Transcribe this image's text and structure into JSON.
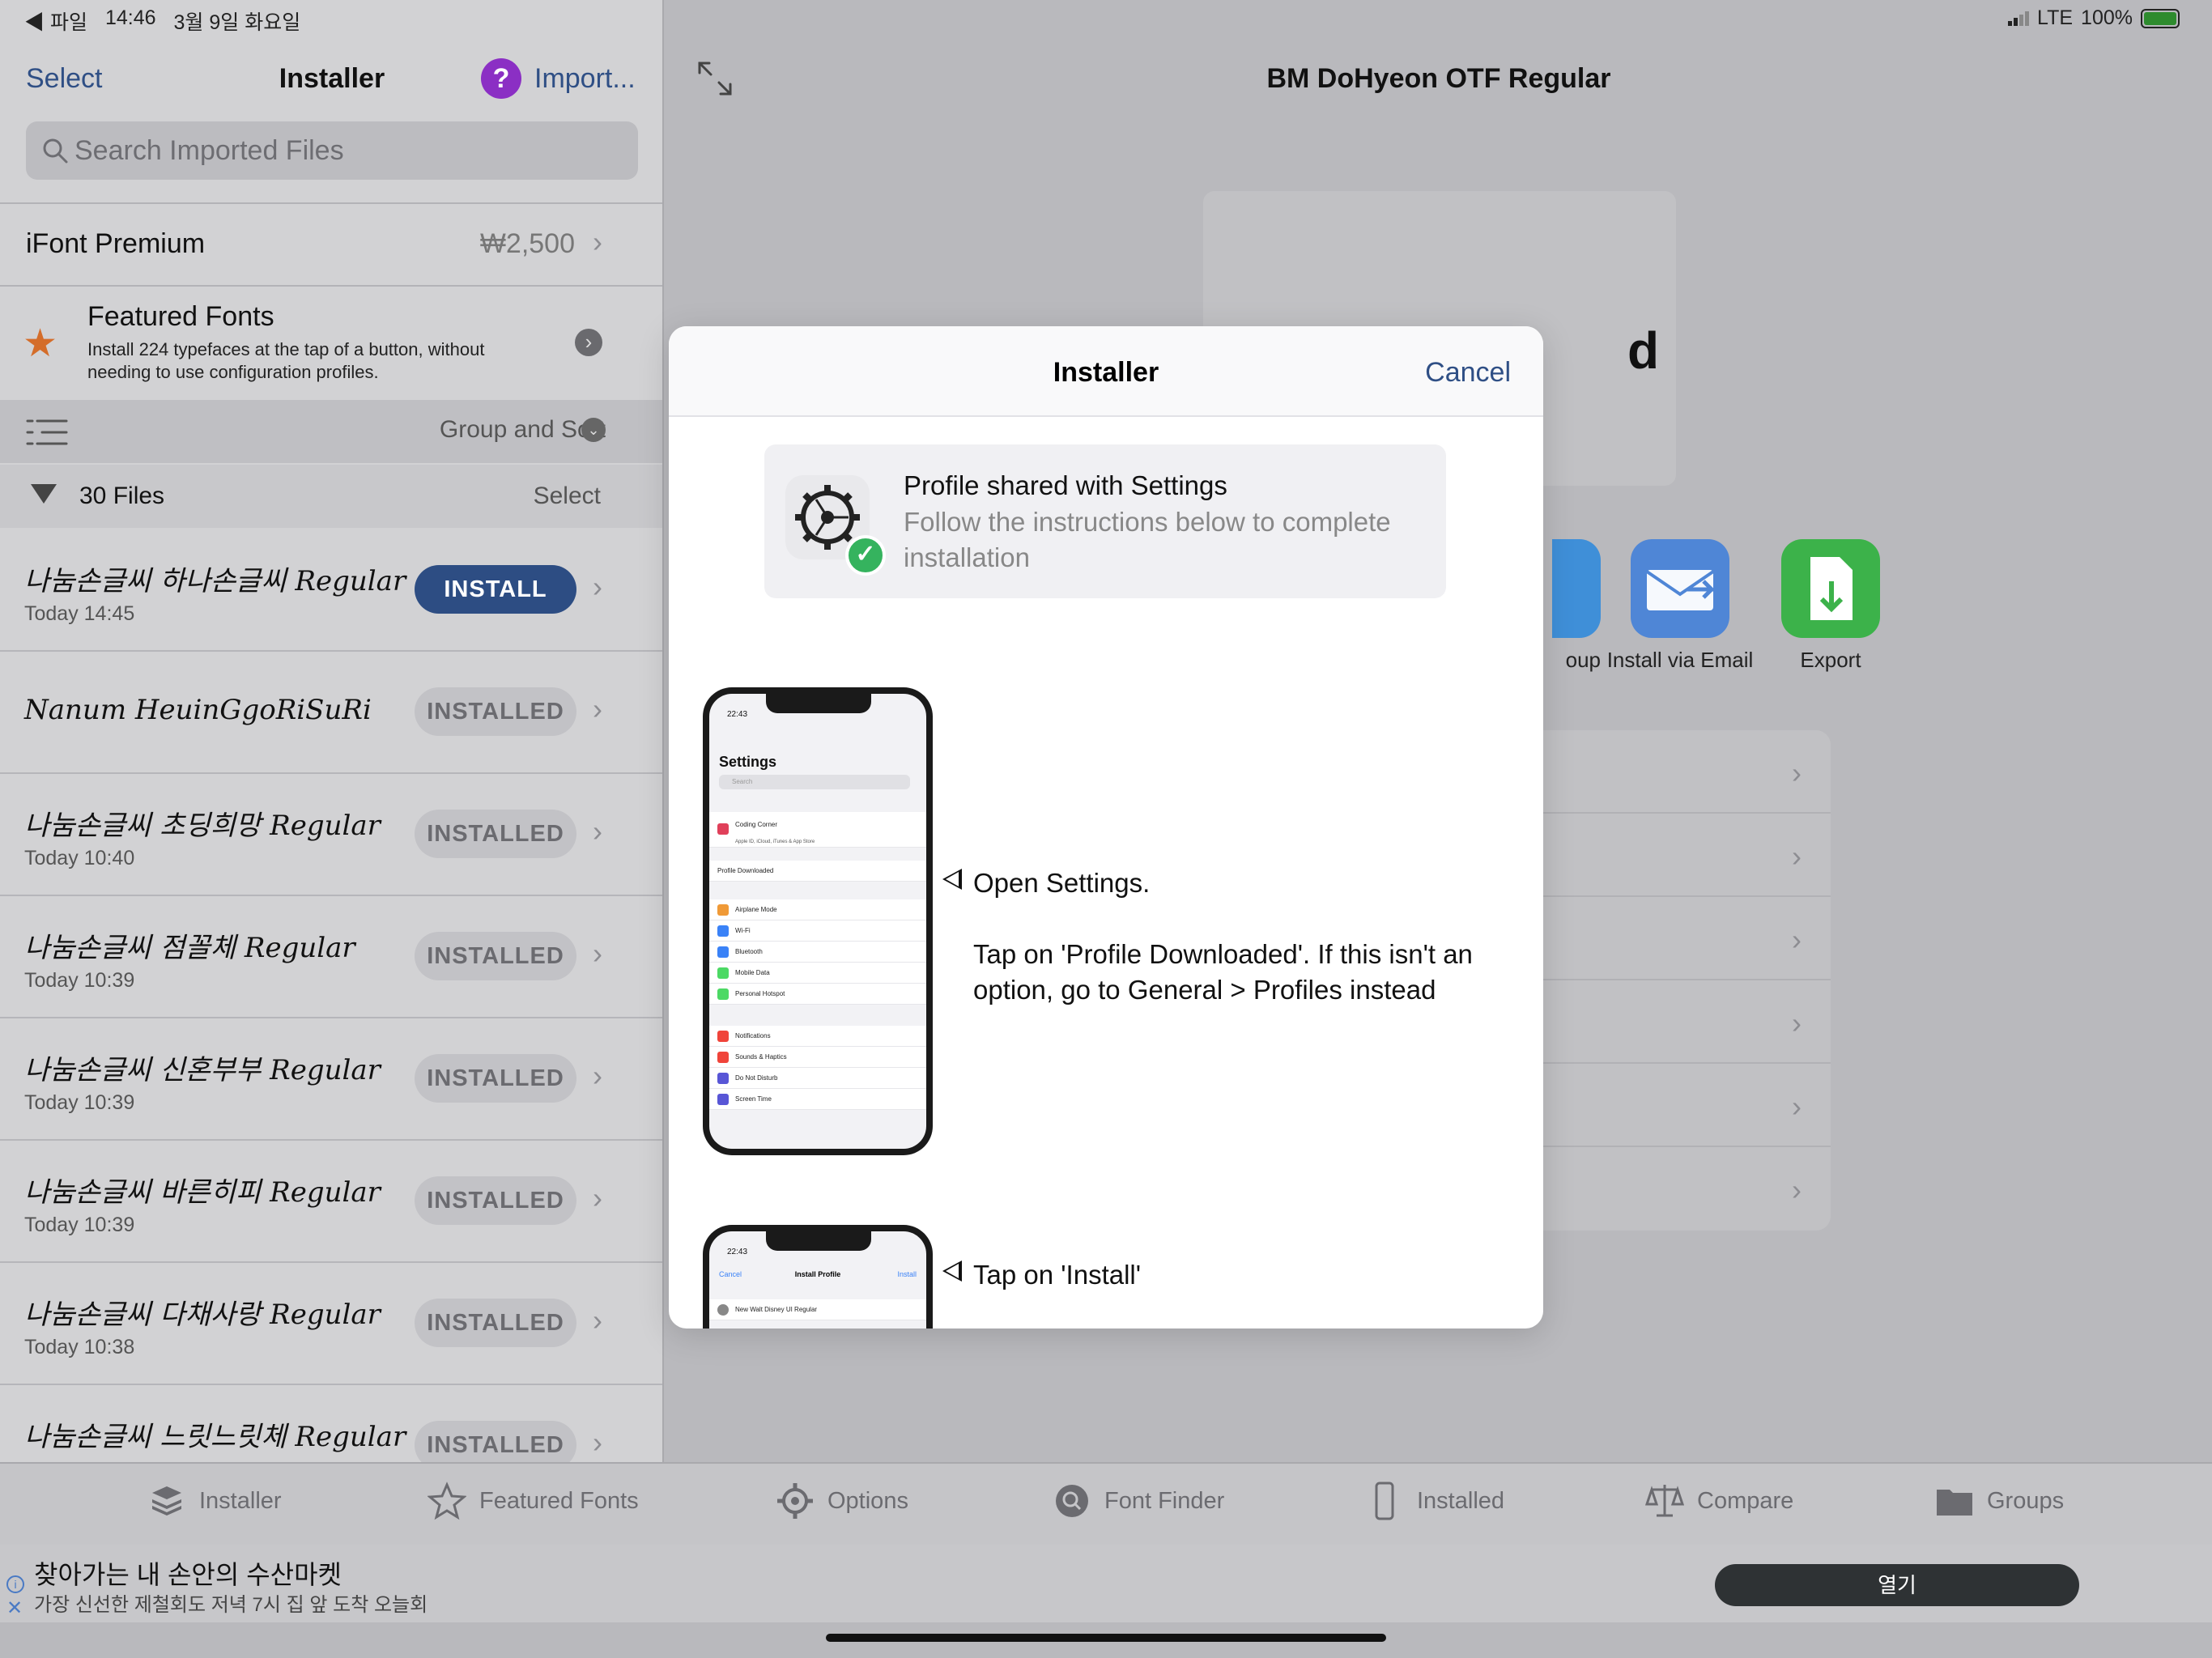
{
  "status_left": {
    "app": "◀ 파일",
    "time": "14:46",
    "date": "3월 9일 화요일"
  },
  "status_right": {
    "network": "LTE",
    "battery": "100%"
  },
  "left": {
    "nav": {
      "select": "Select",
      "title": "Installer",
      "import": "Import..."
    },
    "search": {
      "placeholder": "Search Imported Files"
    },
    "premium": {
      "label": "iFont Premium",
      "price": "₩2,500"
    },
    "featured": {
      "title": "Featured Fonts",
      "desc": "Install 224 typefaces at the tap of a button, without needing to use configuration profiles."
    },
    "group_sort": "Group and Sort",
    "files": {
      "count": "30 Files",
      "select": "Select"
    },
    "fonts": [
      {
        "name": "나눔손글씨 하나손글씨 Regular",
        "date": "Today 14:45",
        "button": "INSTALL",
        "active": true
      },
      {
        "name": "Nanum HeuinGgoRiSuRi",
        "date": "",
        "button": "INSTALLED",
        "active": false
      },
      {
        "name": "나눔손글씨 초딩희망 Regular",
        "date": "Today 10:40",
        "button": "INSTALLED",
        "active": false
      },
      {
        "name": "나눔손글씨 점꼴체 Regular",
        "date": "Today 10:39",
        "button": "INSTALLED",
        "active": false
      },
      {
        "name": "나눔손글씨 신혼부부 Regular",
        "date": "Today 10:39",
        "button": "INSTALLED",
        "active": false
      },
      {
        "name": "나눔손글씨 바른히피 Regular",
        "date": "Today 10:39",
        "button": "INSTALLED",
        "active": false
      },
      {
        "name": "나눔손글씨 다채사랑 Regular",
        "date": "Today 10:38",
        "button": "INSTALLED",
        "active": false
      },
      {
        "name": "나눔손글씨 느릿느릿체 Regular",
        "date": "",
        "button": "INSTALLED",
        "active": false
      }
    ]
  },
  "right": {
    "title": "BM DoHyeon OTF Regular",
    "preview_glyph": "d",
    "actions": [
      {
        "label": "oup",
        "color": "#3f8fd8"
      },
      {
        "label": "Install via Email",
        "color": "#4f86d6"
      },
      {
        "label": "Export",
        "color": "#3cb24a"
      }
    ]
  },
  "modal": {
    "title": "Installer",
    "cancel": "Cancel",
    "profile_title": "Profile shared with Settings",
    "profile_sub": "Follow the instructions below to complete installation",
    "step1_a": "Open Settings.",
    "step1_b": "Tap on 'Profile Downloaded'. If this isn't an option, go to General > Profiles instead",
    "step2": "Tap on 'Install'",
    "phone1": {
      "time": "22:43",
      "heading": "Settings",
      "search": "Search",
      "account": "Coding Corner",
      "account_sub": "Apple ID, iCloud, iTunes & App Store",
      "profile": "Profile Downloaded",
      "items_a": [
        "Airplane Mode",
        "Wi-Fi",
        "Bluetooth",
        "Mobile Data",
        "Personal Hotspot"
      ],
      "items_b": [
        "Notifications",
        "Sounds & Haptics",
        "Do Not Disturb",
        "Screen Time"
      ]
    },
    "phone2": {
      "time": "22:43",
      "cancel": "Cancel",
      "heading": "Install Profile",
      "install": "Install",
      "item": "New Walt Disney UI Regular"
    }
  },
  "tabs": [
    {
      "label": "Installer",
      "icon": "stack-icon"
    },
    {
      "label": "Featured Fonts",
      "icon": "star-icon"
    },
    {
      "label": "Options",
      "icon": "gear-icon"
    },
    {
      "label": "Font Finder",
      "icon": "magnifier-icon"
    },
    {
      "label": "Installed",
      "icon": "phone-icon"
    },
    {
      "label": "Compare",
      "icon": "scale-icon"
    },
    {
      "label": "Groups",
      "icon": "folder-icon"
    }
  ],
  "ad": {
    "title": "찾아가는 내 손안의 수산마켓",
    "subtitle": "가장 신선한 제철회도 저녁 7시 집 앞 도착 오늘회",
    "button": "열기"
  }
}
